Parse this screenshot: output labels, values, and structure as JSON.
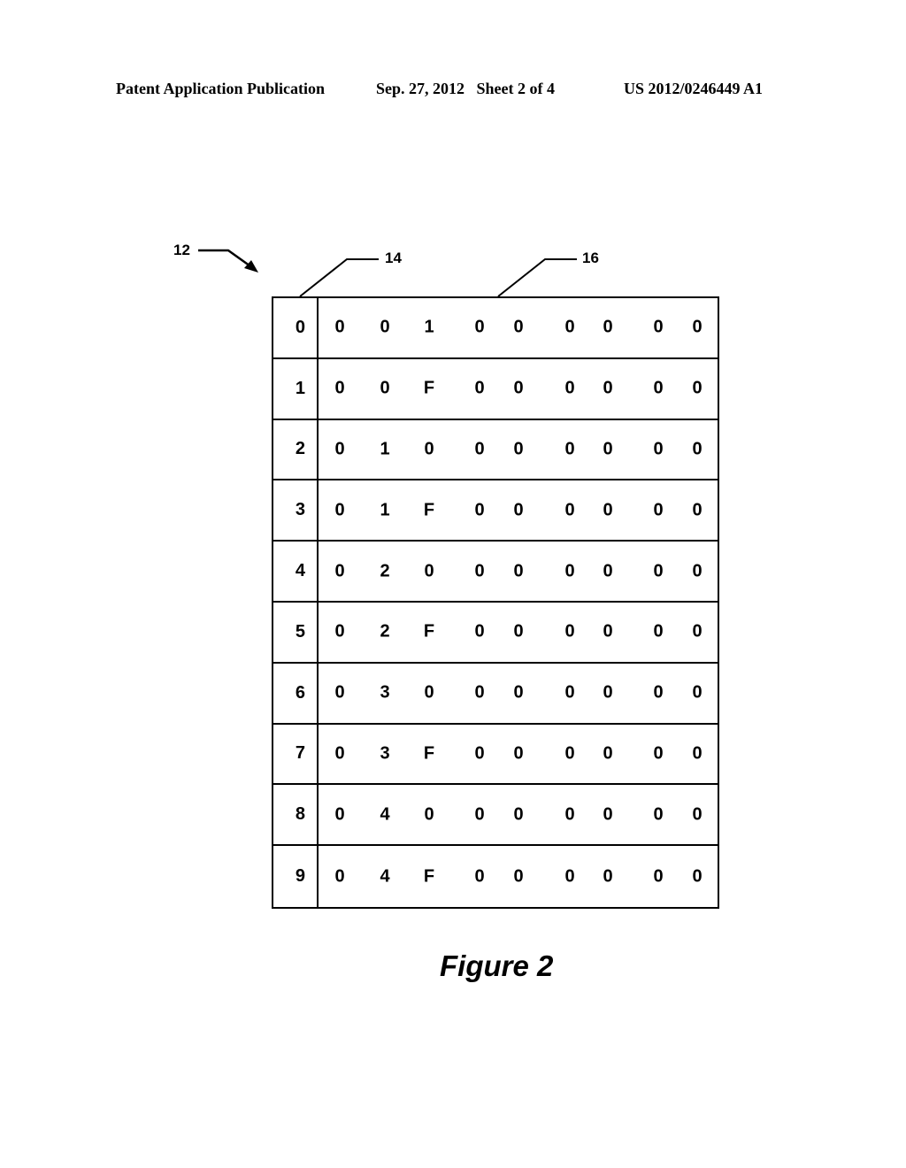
{
  "header": {
    "publication": "Patent Application Publication",
    "date_sheet": "Sep. 27, 2012   Sheet 2 of 4",
    "number": "US 2012/0246449 A1"
  },
  "references": {
    "table_ref": "12",
    "index_column_ref": "14",
    "data_column_ref": "16"
  },
  "table": {
    "rows": [
      {
        "index": "0",
        "cells": [
          "0",
          "0",
          "1",
          "0",
          "0",
          "0",
          "0",
          "0",
          "0"
        ]
      },
      {
        "index": "1",
        "cells": [
          "0",
          "0",
          "F",
          "0",
          "0",
          "0",
          "0",
          "0",
          "0"
        ]
      },
      {
        "index": "2",
        "cells": [
          "0",
          "1",
          "0",
          "0",
          "0",
          "0",
          "0",
          "0",
          "0"
        ]
      },
      {
        "index": "3",
        "cells": [
          "0",
          "1",
          "F",
          "0",
          "0",
          "0",
          "0",
          "0",
          "0"
        ]
      },
      {
        "index": "4",
        "cells": [
          "0",
          "2",
          "0",
          "0",
          "0",
          "0",
          "0",
          "0",
          "0"
        ]
      },
      {
        "index": "5",
        "cells": [
          "0",
          "2",
          "F",
          "0",
          "0",
          "0",
          "0",
          "0",
          "0"
        ]
      },
      {
        "index": "6",
        "cells": [
          "0",
          "3",
          "0",
          "0",
          "0",
          "0",
          "0",
          "0",
          "0"
        ]
      },
      {
        "index": "7",
        "cells": [
          "0",
          "3",
          "F",
          "0",
          "0",
          "0",
          "0",
          "0",
          "0"
        ]
      },
      {
        "index": "8",
        "cells": [
          "0",
          "4",
          "0",
          "0",
          "0",
          "0",
          "0",
          "0",
          "0"
        ]
      },
      {
        "index": "9",
        "cells": [
          "0",
          "4",
          "F",
          "0",
          "0",
          "0",
          "0",
          "0",
          "0"
        ]
      }
    ]
  },
  "figure": {
    "caption": "Figure 2"
  }
}
